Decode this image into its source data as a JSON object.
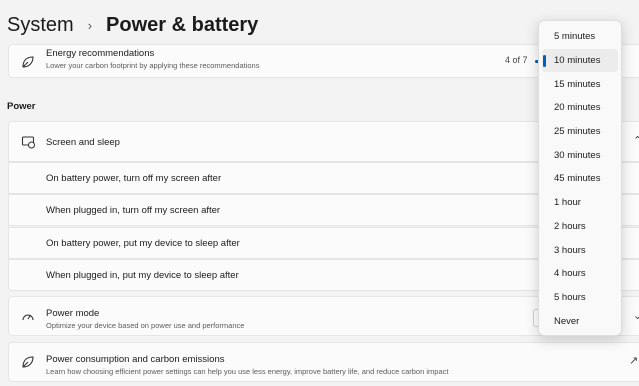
{
  "breadcrumb": {
    "parent": "System",
    "separator": "›",
    "current": "Power & battery"
  },
  "energy": {
    "title": "Energy recommendations",
    "subtitle": "Lower your carbon footprint by applying these recommendations",
    "count": "4 of 7",
    "progress_fraction": 0.57
  },
  "section": {
    "power_label": "Power"
  },
  "screen_sleep": {
    "title": "Screen and sleep",
    "items": [
      "On battery power, turn off my screen after",
      "When plugged in, turn off my screen after",
      "On battery power, put my device to sleep after",
      "When plugged in, put my device to sleep after"
    ]
  },
  "power_mode": {
    "title": "Power mode",
    "subtitle": "Optimize your device based on power use and performance",
    "value_prefix": "Be"
  },
  "consumption": {
    "title": "Power consumption and carbon emissions",
    "subtitle": "Learn how choosing efficient power settings can help you use less energy, improve battery life, and reduce carbon impact"
  },
  "dropdown": {
    "options": [
      "5 minutes",
      "10 minutes",
      "15 minutes",
      "20 minutes",
      "25 minutes",
      "30 minutes",
      "45 minutes",
      "1 hour",
      "2 hours",
      "3 hours",
      "4 hours",
      "5 hours",
      "Never"
    ],
    "selected_index": 1
  },
  "colors": {
    "accent": "#005fb8",
    "background": "#f3f3f3",
    "card": "#fbfbfb"
  }
}
